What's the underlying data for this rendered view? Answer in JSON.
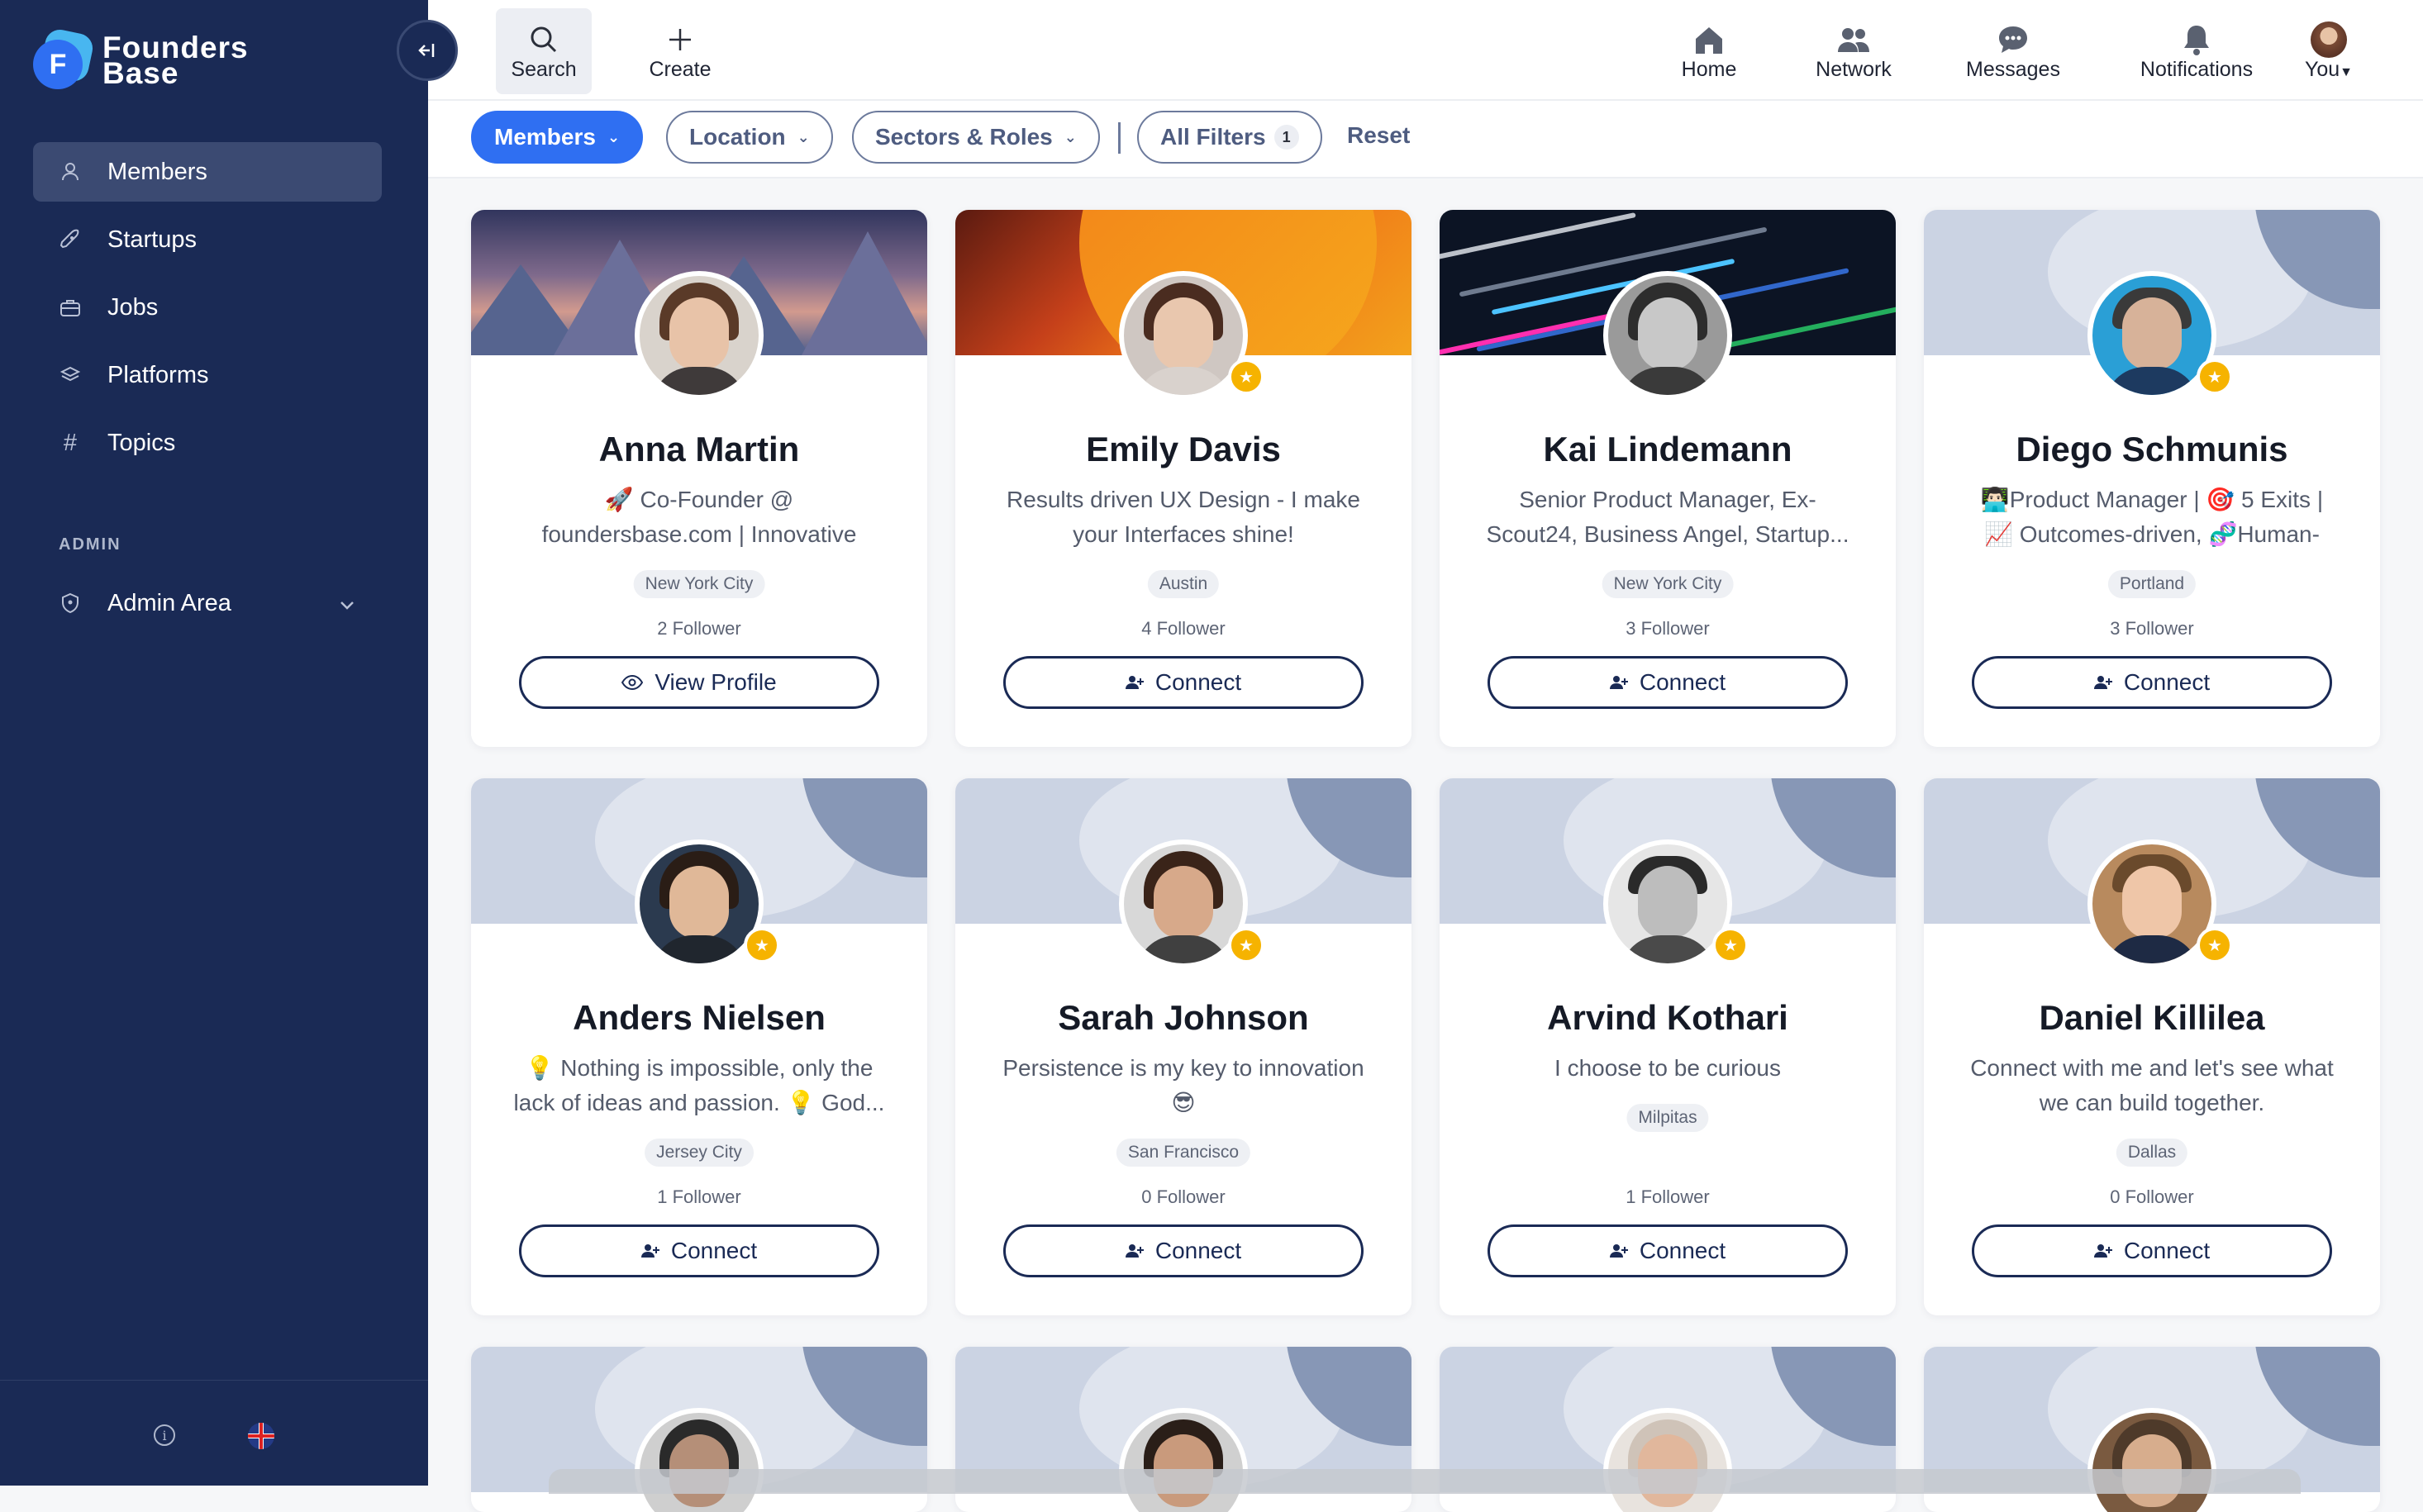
{
  "brand": {
    "line1": "Founders",
    "line2": "Base",
    "mark": "F"
  },
  "sidebar": {
    "items": [
      {
        "label": "Members",
        "icon": "user-icon"
      },
      {
        "label": "Startups",
        "icon": "rocket-icon"
      },
      {
        "label": "Jobs",
        "icon": "briefcase-icon"
      },
      {
        "label": "Platforms",
        "icon": "layers-icon"
      },
      {
        "label": "Topics",
        "icon": "hash-icon"
      }
    ],
    "section_label": "ADMIN",
    "admin_label": "Admin Area",
    "hash_glyph": "#"
  },
  "topbar": {
    "search": "Search",
    "create": "Create",
    "home": "Home",
    "network": "Network",
    "messages": "Messages",
    "notifications": "Notifications",
    "you": "You"
  },
  "filters": {
    "members": "Members",
    "location": "Location",
    "sectors": "Sectors & Roles",
    "all_filters": "All Filters",
    "all_filters_count": "1",
    "reset": "Reset"
  },
  "cards": [
    {
      "name": "Anna Martin",
      "tagline": "🚀 Co-Founder @ foundersbase.com | Innovative Marketing Manager |...",
      "city": "New York City",
      "followers": "2 Follower",
      "cta": "View Profile"
    },
    {
      "name": "Emily Davis",
      "tagline": "Results driven UX Design - I make your Interfaces shine!",
      "city": "Austin",
      "followers": "4 Follower",
      "cta": "Connect"
    },
    {
      "name": "Kai Lindemann",
      "tagline": "Senior Product Manager, Ex-Scout24, Business Angel, Startup...",
      "city": "New York City",
      "followers": "3 Follower",
      "cta": "Connect"
    },
    {
      "name": "Diego Schmunis",
      "tagline": "👨🏻‍💻Product Manager | 🎯 5 Exits | 📈 Outcomes-driven, 🧬Human-centri...",
      "city": "Portland",
      "followers": "3 Follower",
      "cta": "Connect"
    },
    {
      "name": "Anders Nielsen",
      "tagline": "💡 Nothing is impossible, only the lack of ideas and passion. 💡 God...",
      "city": "Jersey City",
      "followers": "1 Follower",
      "cta": "Connect"
    },
    {
      "name": "Sarah Johnson",
      "tagline": "Persistence is my key to innovation 😎",
      "city": "San Francisco",
      "followers": "0 Follower",
      "cta": "Connect"
    },
    {
      "name": "Arvind Kothari",
      "tagline": "I choose to be curious",
      "city": "Milpitas",
      "followers": "1 Follower",
      "cta": "Connect"
    },
    {
      "name": "Daniel Killilea",
      "tagline": "Connect with me and let's see what we can build together.",
      "city": "Dallas",
      "followers": "0 Follower",
      "cta": "Connect"
    }
  ]
}
